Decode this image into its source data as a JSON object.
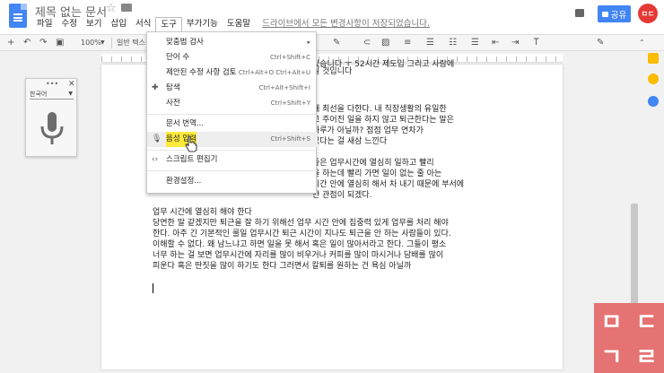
{
  "app": {
    "title": "제목 없는 문서",
    "save_status": "드라이브에서 모든 변경사항이 저장되었습니다.",
    "share_label": "공유",
    "avatar_text": "ㅁㄷ"
  },
  "menubar": {
    "items": [
      "파일",
      "수정",
      "보기",
      "삽입",
      "서식",
      "도구",
      "부가기능",
      "도움말"
    ]
  },
  "toolbar": {
    "zoom": "100%",
    "style": "일반 텍스"
  },
  "tools_menu": {
    "items": [
      {
        "label": "맞춤법 검사",
        "shortcut": "",
        "submenu": "▸"
      },
      {
        "label": "단어 수",
        "shortcut": "Ctrl+Shift+C"
      },
      {
        "label": "제안된 수정 사항 검토",
        "shortcut": "Ctrl+Alt+O Ctrl+Alt+U"
      },
      {
        "label": "탐색",
        "shortcut": "Ctrl+Alt+Shift+I"
      },
      {
        "label": "사전",
        "shortcut": "Ctrl+Shift+Y"
      },
      {
        "label": "문서 번역...",
        "shortcut": ""
      },
      {
        "label": "음성 입력",
        "shortcut": "Ctrl+Shift+S"
      },
      {
        "label": "스크립트 편집기",
        "shortcut": ""
      },
      {
        "label": "환경설정...",
        "shortcut": ""
      }
    ]
  },
  "voice_panel": {
    "language": "한국어"
  },
  "document": {
    "lines_right": [
      "있습니다 ㅜ 52시간 제도입 그리고 사람에",
      "될 것입니다",
      "해 최선을 다한다.  내 직장생활의 유일한",
      "고 주어진 일을 하지 않고 퇴근한다는 말은",
      "하루가 아닐까? 점점 업무 연차가",
      "있다는 걸 새삼 느낀다",
      "좋은 업무시간에 열심히 일하고 빨리",
      "을 하는데 빨리 가면 일이 없는 줄 아는",
      "시간 안에 열심히 해서 차 내기 때문에 부서에",
      "안 관점이 되겠다."
    ],
    "paragraph": [
      "업무 시간에 열심히 해야 한다",
      "당연한 말 같겠지만 퇴근을 잘 하기 위해선 업무 시간 안에 집중력 있게 업무를 처리 해야",
      "한다.  아주 긴 기본적인 룰일 업무시간 퇴근 시간이 지나도 퇴근을 안 하는 사람들이 있다.",
      "이해할 수 없다.  왜 남느냐고 하면 일을 못 해서 혹은 일이 많아서라고 한다. 그들이 평소",
      "너무 하는 걸 보면 업무시간에 자리를 많이 비우거나 커피를 많이 마시거나 담배를 많이",
      "피운다 혹은 딴짓을 많이 하기도 한다 그러면서 칼퇴를 원하는 건 욕심 아닐까"
    ]
  },
  "watermark": {
    "cells": [
      "ㅁ",
      "ㄷ",
      "ㄱ",
      "ㄹ"
    ]
  },
  "colors": {
    "brand": "#4285f4",
    "avatar": "#e53935",
    "watermark": "#e57373",
    "highlight": "#ffea3b"
  }
}
